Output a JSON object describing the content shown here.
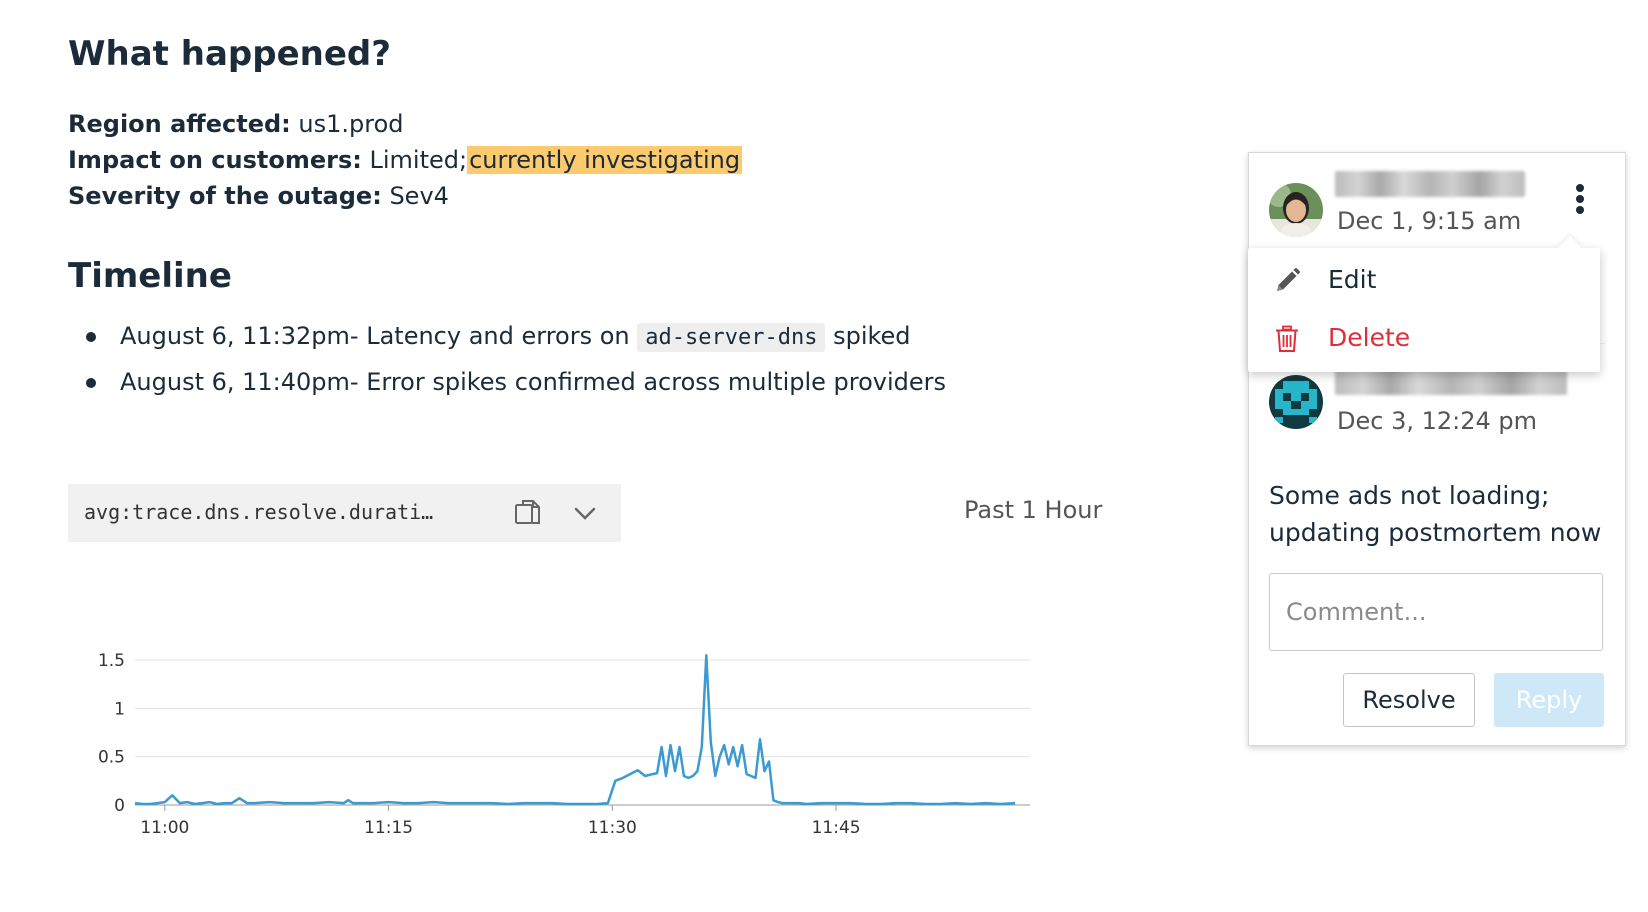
{
  "doc": {
    "heading": "What happened?",
    "region_label": "Region affected:",
    "region_value": "us1.prod",
    "impact_label": "Impact on customers:",
    "impact_value": "Limited;",
    "impact_highlight": "currently investigating",
    "severity_label": "Severity of the outage:",
    "severity_value": "Sev4",
    "timeline_heading": "Timeline",
    "timeline": [
      {
        "prefix": "August 6, 11:32pm- Latency and errors on",
        "code": "ad-server-dns",
        "suffix": "spiked"
      },
      {
        "text": "August 6, 11:40pm- Error spikes confirmed across multiple providers"
      }
    ]
  },
  "widget": {
    "query": "avg:trace.dns.resolve.durati…",
    "copy_icon": "copy-icon",
    "expand_icon": "chevron-down-icon",
    "timeframe": "Past 1 Hour"
  },
  "chart_data": {
    "type": "line",
    "color": "#3b9bd1",
    "xlabel": "",
    "ylabel": "",
    "ylim": [
      0,
      1.5
    ],
    "yticks": [
      "0",
      "0.5",
      "1",
      "1.5"
    ],
    "xticks": [
      {
        "label": "11:00",
        "minute": 0
      },
      {
        "label": "11:15",
        "minute": 15
      },
      {
        "label": "11:30",
        "minute": 30
      },
      {
        "label": "11:45",
        "minute": 45
      }
    ],
    "xlim_minutes": [
      -2,
      58
    ],
    "series": [
      {
        "x": [
          -2,
          -1.5,
          -1,
          -0.5,
          0,
          0.5,
          1,
          1.5,
          2,
          2.5,
          3,
          3.5,
          4,
          4.5,
          5,
          5.5,
          6,
          7,
          8,
          9,
          10,
          11,
          12,
          12.3,
          12.6,
          13,
          14,
          15,
          16,
          17,
          18,
          19,
          20,
          21,
          22,
          23,
          24,
          25,
          26,
          27,
          28,
          29,
          29.7,
          30.2,
          30.7,
          31.2,
          31.7,
          32.2,
          32.7,
          33.0,
          33.3,
          33.6,
          33.9,
          34.2,
          34.5,
          34.8,
          35.1,
          35.4,
          35.7,
          36.0,
          36.3,
          36.6,
          36.9,
          37.2,
          37.5,
          37.8,
          38.1,
          38.4,
          38.7,
          39.0,
          39.3,
          39.6,
          39.9,
          40.2,
          40.5,
          40.8,
          41.1,
          41.4,
          41.8,
          42.5,
          43,
          44,
          45,
          46,
          47,
          48,
          49,
          50,
          51,
          52,
          53,
          54,
          55,
          56,
          57
        ],
        "y": [
          0.02,
          0.01,
          0.01,
          0.02,
          0.03,
          0.1,
          0.02,
          0.03,
          0.01,
          0.02,
          0.03,
          0.01,
          0.02,
          0.02,
          0.07,
          0.02,
          0.02,
          0.03,
          0.02,
          0.02,
          0.02,
          0.03,
          0.02,
          0.05,
          0.02,
          0.02,
          0.02,
          0.03,
          0.02,
          0.02,
          0.03,
          0.02,
          0.02,
          0.02,
          0.02,
          0.01,
          0.02,
          0.02,
          0.02,
          0.01,
          0.01,
          0.01,
          0.02,
          0.25,
          0.28,
          0.32,
          0.36,
          0.3,
          0.32,
          0.33,
          0.6,
          0.3,
          0.62,
          0.35,
          0.6,
          0.3,
          0.28,
          0.3,
          0.35,
          0.6,
          1.55,
          0.65,
          0.3,
          0.5,
          0.62,
          0.42,
          0.6,
          0.4,
          0.62,
          0.32,
          0.3,
          0.28,
          0.68,
          0.35,
          0.45,
          0.05,
          0.03,
          0.02,
          0.02,
          0.02,
          0.01,
          0.02,
          0.02,
          0.02,
          0.01,
          0.01,
          0.02,
          0.02,
          0.01,
          0.01,
          0.02,
          0.01,
          0.02,
          0.01,
          0.02
        ]
      }
    ],
    "grid": true
  },
  "comments": {
    "first": {
      "avatar_icon": "user-avatar-photo",
      "timestamp": "Dec 1, 9:15 am",
      "menu_icon": "kebab-menu-icon"
    },
    "menu": {
      "edit_label": "Edit",
      "edit_icon": "pencil-icon",
      "delete_label": "Delete",
      "delete_icon": "trash-icon",
      "delete_color": "#e02d3c"
    },
    "second": {
      "avatar_icon": "pixel-avatar-icon",
      "timestamp": "Dec 3, 12:24 pm",
      "body": "Some ads not loading; updating postmortem now"
    },
    "input_placeholder": "Comment...",
    "resolve_label": "Resolve",
    "reply_label": "Reply"
  }
}
